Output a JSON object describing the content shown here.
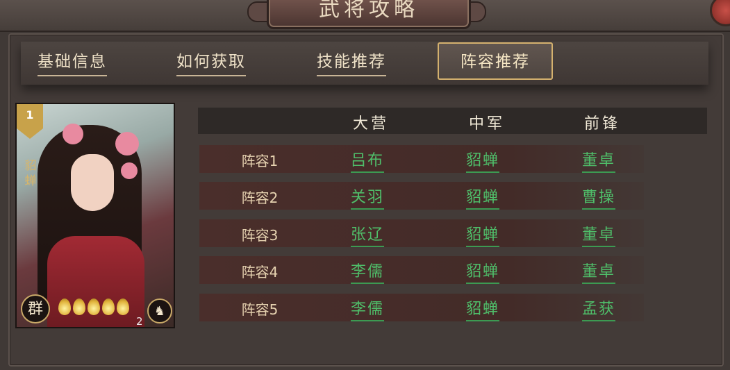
{
  "window": {
    "title": "武将攻略"
  },
  "tabs": [
    {
      "label": "基础信息"
    },
    {
      "label": "如何获取"
    },
    {
      "label": "技能推荐"
    },
    {
      "label": "阵容推荐",
      "active": true
    }
  ],
  "card": {
    "rank": "1",
    "name": "貂蝉",
    "faction": "群",
    "stars": 5,
    "level": "2",
    "type_icon": "horse-icon"
  },
  "table": {
    "headers": [
      "大营",
      "中军",
      "前锋"
    ],
    "rows": [
      {
        "label": "阵容1",
        "cells": [
          "吕布",
          "貂蝉",
          "董卓"
        ]
      },
      {
        "label": "阵容2",
        "cells": [
          "关羽",
          "貂蝉",
          "曹操"
        ]
      },
      {
        "label": "阵容3",
        "cells": [
          "张辽",
          "貂蝉",
          "董卓"
        ]
      },
      {
        "label": "阵容4",
        "cells": [
          "李儒",
          "貂蝉",
          "董卓"
        ]
      },
      {
        "label": "阵容5",
        "cells": [
          "李儒",
          "貂蝉",
          "孟获"
        ]
      }
    ]
  },
  "colors": {
    "accent_gold": "#d4b16e",
    "hero_link_green": "#4fbf6a",
    "row_bg": "#4a2e2b"
  }
}
